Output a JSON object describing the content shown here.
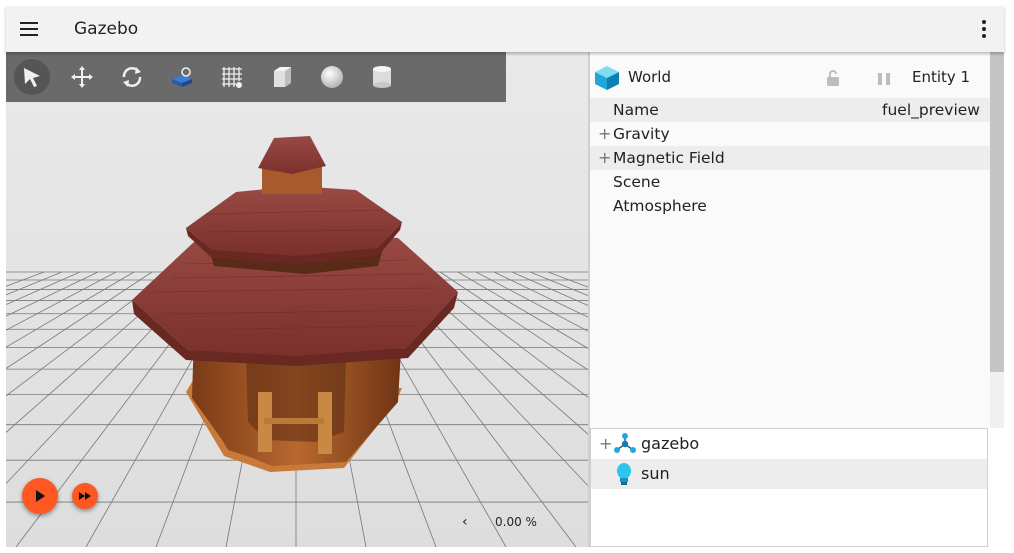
{
  "app": {
    "title": "Gazebo"
  },
  "toolbar": {
    "tools": [
      {
        "name": "select",
        "icon": "arrow-cursor-icon"
      },
      {
        "name": "translate",
        "icon": "move-arrows-icon"
      },
      {
        "name": "rotate",
        "icon": "rotate-icon"
      },
      {
        "name": "transform-control",
        "icon": "transform-icon"
      },
      {
        "name": "grid",
        "icon": "grid-icon"
      },
      {
        "name": "box",
        "icon": "box-icon"
      },
      {
        "name": "sphere",
        "icon": "sphere-icon"
      },
      {
        "name": "cylinder",
        "icon": "cylinder-icon"
      }
    ]
  },
  "playback": {
    "rtf_chevron": "‹",
    "real_time_factor": "0.00 %"
  },
  "inspector": {
    "entity_name": "World",
    "entity_id": "Entity 1",
    "properties": [
      {
        "label": "Name",
        "value": "fuel_preview",
        "expandable": false
      },
      {
        "label": "Gravity",
        "value": "",
        "expandable": true
      },
      {
        "label": "Magnetic Field",
        "value": "",
        "expandable": true
      },
      {
        "label": "Scene",
        "value": "",
        "expandable": false
      },
      {
        "label": "Atmosphere",
        "value": "",
        "expandable": false
      }
    ]
  },
  "entity_tree": {
    "items": [
      {
        "label": "gazebo",
        "icon": "model-icon",
        "expandable": true
      },
      {
        "label": "sun",
        "icon": "light-bulb-icon",
        "expandable": false
      }
    ]
  },
  "colors": {
    "accent": "#ff5722",
    "toolbar_bg": "#6a6a6a",
    "roof": "#8c3c38",
    "wood": "#a8582a"
  },
  "plus_glyph": "+"
}
